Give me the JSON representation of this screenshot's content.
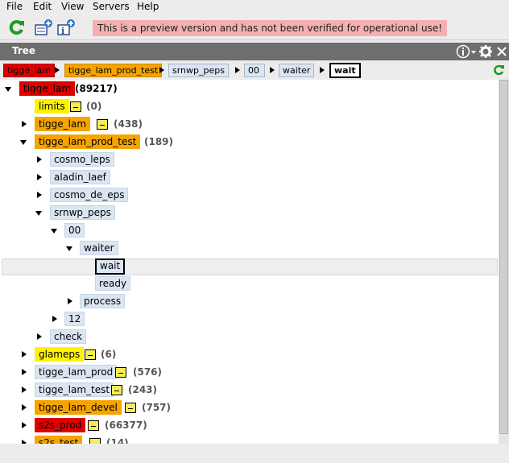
{
  "menu": {
    "file": "File",
    "edit": "Edit",
    "view": "View",
    "servers": "Servers",
    "help": "Help"
  },
  "toolbar": {
    "warning": "This is a preview version and has not been verified for operational use!"
  },
  "panel": {
    "title": "Tree"
  },
  "breadcrumb": [
    "tigge_lam",
    "tigge_lam_prod_test",
    "srnwp_peps",
    "00",
    "waiter",
    "wait"
  ],
  "tree": {
    "root": {
      "label": "tigge_lam",
      "count": "(89217)"
    },
    "limits": {
      "label": "limits",
      "count": "(0)"
    },
    "tigge_lam_child": {
      "label": "tigge_lam",
      "count": "(438)"
    },
    "prod_test": {
      "label": "tigge_lam_prod_test",
      "count": "(189)"
    },
    "cosmo_leps": "cosmo_leps",
    "aladin_laef": "aladin_laef",
    "cosmo_de_eps": "cosmo_de_eps",
    "srnwp_peps": "srnwp_peps",
    "n00": "00",
    "waiter": "waiter",
    "wait": "wait",
    "ready": "ready",
    "process": "process",
    "n12": "12",
    "check": "check",
    "glameps": {
      "label": "glameps",
      "count": "(6)"
    },
    "prod": {
      "label": "tigge_lam_prod",
      "count": "(576)"
    },
    "test": {
      "label": "tigge_lam_test",
      "count": "(243)"
    },
    "devel": {
      "label": "tigge_lam_devel",
      "count": "(757)"
    },
    "s2s_prod": {
      "label": "s2s_prod",
      "count": "(66377)"
    },
    "s2s_test": {
      "label": "s2s_test",
      "count": "(14)"
    }
  }
}
